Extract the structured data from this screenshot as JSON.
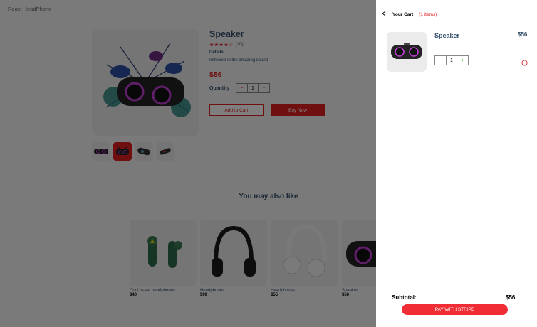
{
  "logo": "React HeadPhone",
  "product": {
    "title": "Speaker",
    "stars": "★★★★☆",
    "reviews": "(20)",
    "details_heading": "Details:",
    "details": "Immerse in the amazing sound",
    "price": "$56",
    "quantity_label": "Quantity",
    "qty_minus": "−",
    "qty_value": "1",
    "qty_plus": "+",
    "add_to_cart": "Add to Cart",
    "buy_now": "Buy Now"
  },
  "may_also_like": {
    "heading": "You may also like",
    "items": [
      {
        "name": "Cool in-ear headphones",
        "price": "$40"
      },
      {
        "name": "Headphones",
        "price": "$99"
      },
      {
        "name": "Headphones",
        "price": "$55"
      },
      {
        "name": "Speaker",
        "price": "$56"
      }
    ]
  },
  "cart": {
    "title": "Your Cart",
    "count": "(1 items)",
    "item": {
      "name": "Speaker",
      "price": "$56",
      "qty_minus": "−",
      "qty_value": "1",
      "qty_plus": "+"
    },
    "subtotal_label": "Subtotal:",
    "subtotal_value": "$56",
    "pay_button": "PAY WITH STRIPE"
  },
  "colors": {
    "accent": "#e01f1f",
    "text": "#324d67",
    "card_bg": "#ebebeb"
  }
}
